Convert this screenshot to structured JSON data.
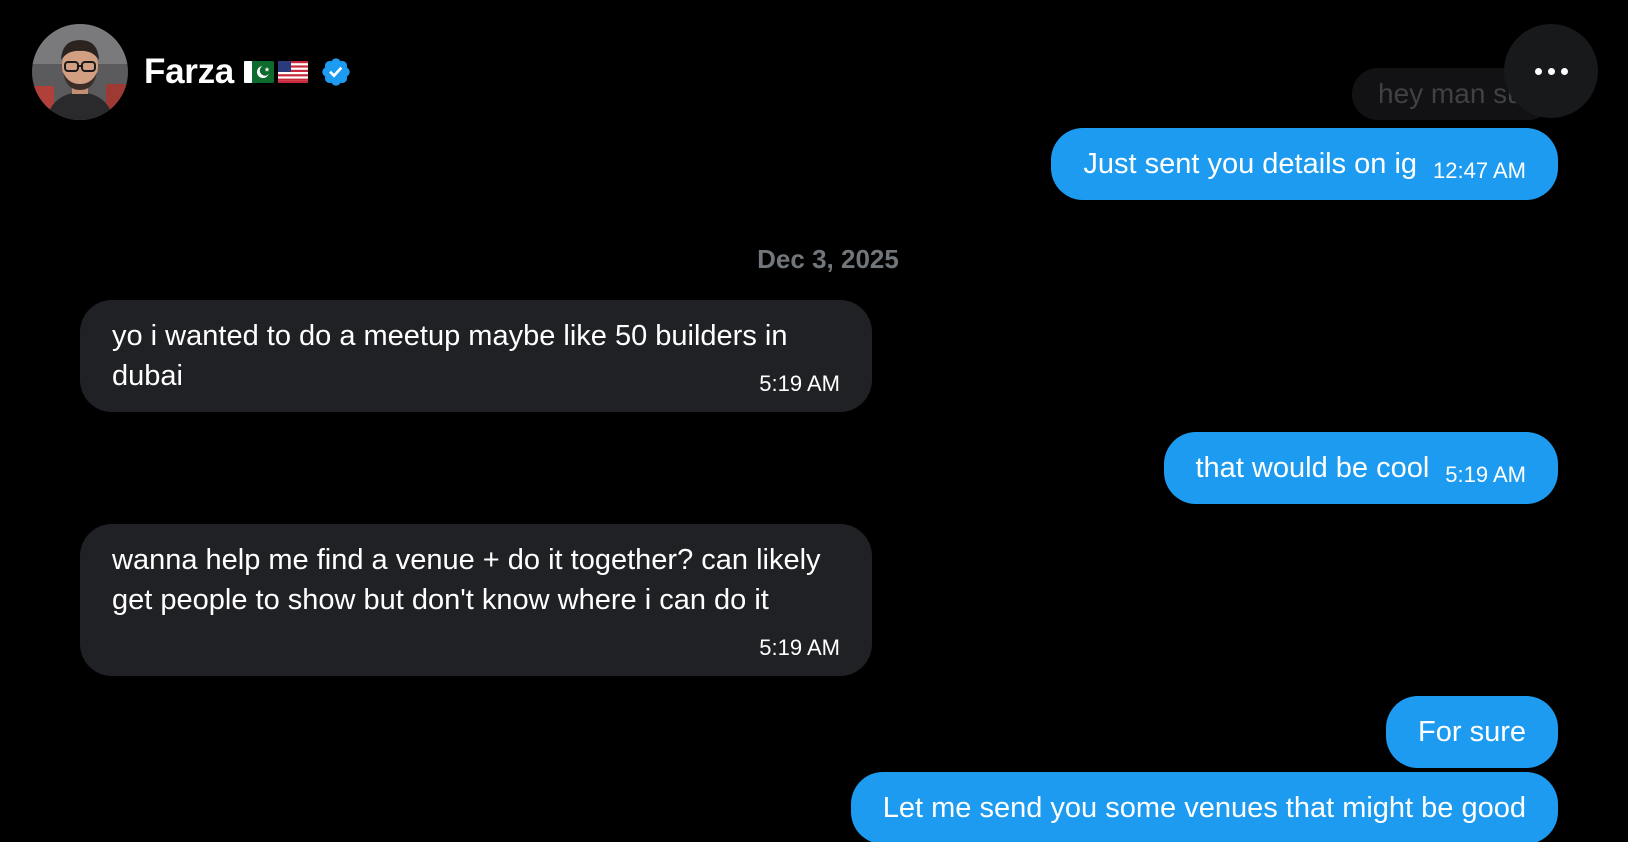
{
  "header": {
    "name": "Farza",
    "flags": [
      "pakistan-flag",
      "usa-flag"
    ],
    "verified_icon": "verified-badge-icon",
    "more_icon": "more-horizontal-icon",
    "accent": "#1d9bf0"
  },
  "conversation": {
    "faded_preview": "hey man su",
    "first_sent": {
      "text": "Just sent you details on ig",
      "time": "12:47 AM"
    },
    "date_separator": "Dec 3, 2025",
    "messages": [
      {
        "direction": "received",
        "text": "yo i wanted to do a meetup maybe like 50 builders in dubai",
        "time": "5:19 AM"
      },
      {
        "direction": "sent",
        "text": "that would be cool",
        "time": "5:19 AM"
      },
      {
        "direction": "received",
        "text": "wanna help me find a venue + do it together? can likely get people to show but don't know where i can do it",
        "time": "5:19 AM"
      },
      {
        "direction": "sent",
        "text": "For sure",
        "time": ""
      },
      {
        "direction": "sent",
        "text": "Let me send you some venues that might be good",
        "time": ""
      }
    ]
  },
  "colors": {
    "background": "#000000",
    "sent_bubble": "#1d9bf0",
    "received_bubble": "#202124",
    "muted_text": "#71767b"
  }
}
